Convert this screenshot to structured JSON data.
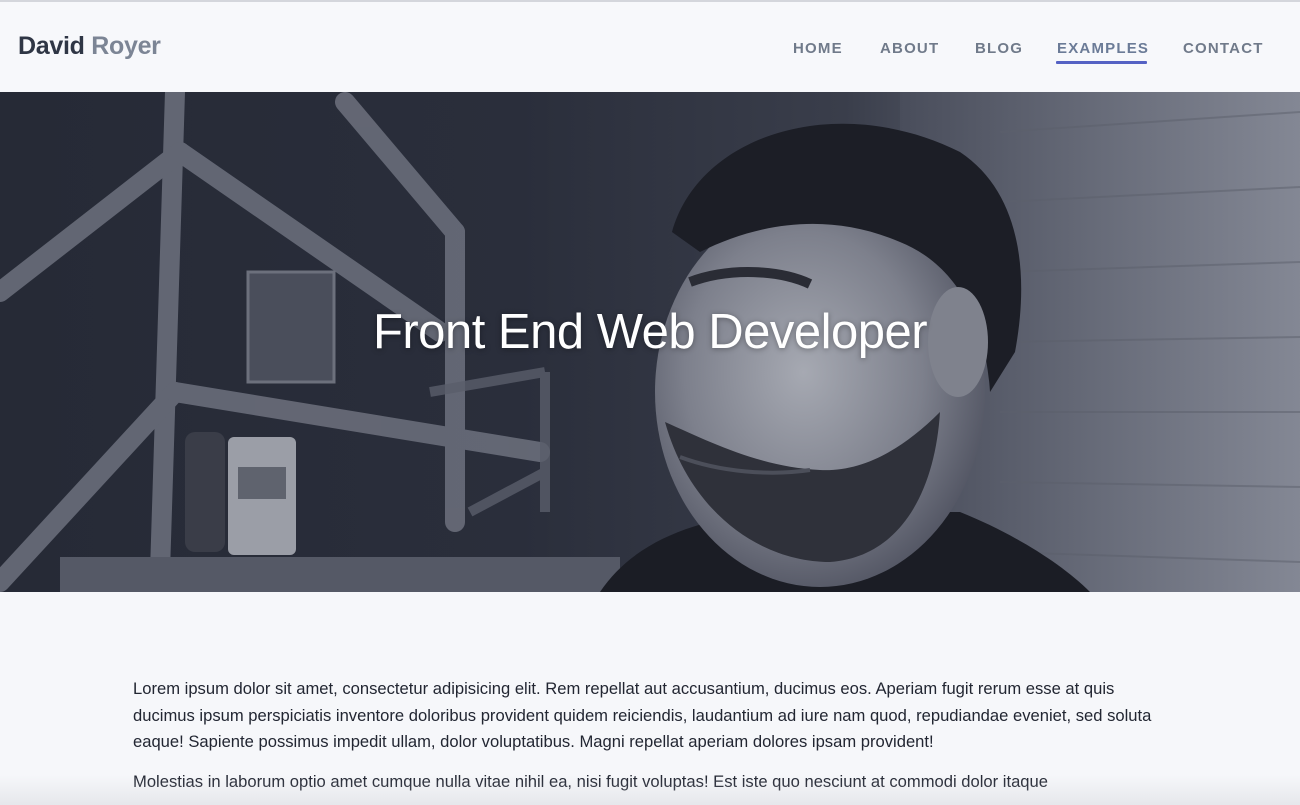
{
  "header": {
    "brand_first": "David",
    "brand_last": "Royer",
    "nav": [
      {
        "label": "HOME"
      },
      {
        "label": "ABOUT"
      },
      {
        "label": "BLOG"
      },
      {
        "label": "EXAMPLES",
        "active": true
      },
      {
        "label": "CONTACT"
      }
    ]
  },
  "hero": {
    "title": "Front End Web Developer"
  },
  "content": {
    "paragraphs": [
      "Lorem ipsum dolor sit amet, consectetur adipisicing elit. Rem repellat aut accusantium, ducimus eos. Aperiam fugit rerum esse at quis ducimus ipsum perspiciatis inventore doloribus provident quidem reiciendis, laudantium ad iure nam quod, repudiandae eveniet, sed soluta eaque! Sapiente possimus impedit ullam, dolor voluptatibus. Magni repellat aperiam dolores ipsam provident!",
      "Molestias in laborum optio amet cumque nulla vitae nihil ea, nisi fugit voluptas! Est iste quo nesciunt at commodi dolor itaque"
    ]
  },
  "colors": {
    "accent": "#5562c4",
    "brand_dark": "#2f3645",
    "brand_light": "#7c8595",
    "nav_text": "#707a8a"
  }
}
